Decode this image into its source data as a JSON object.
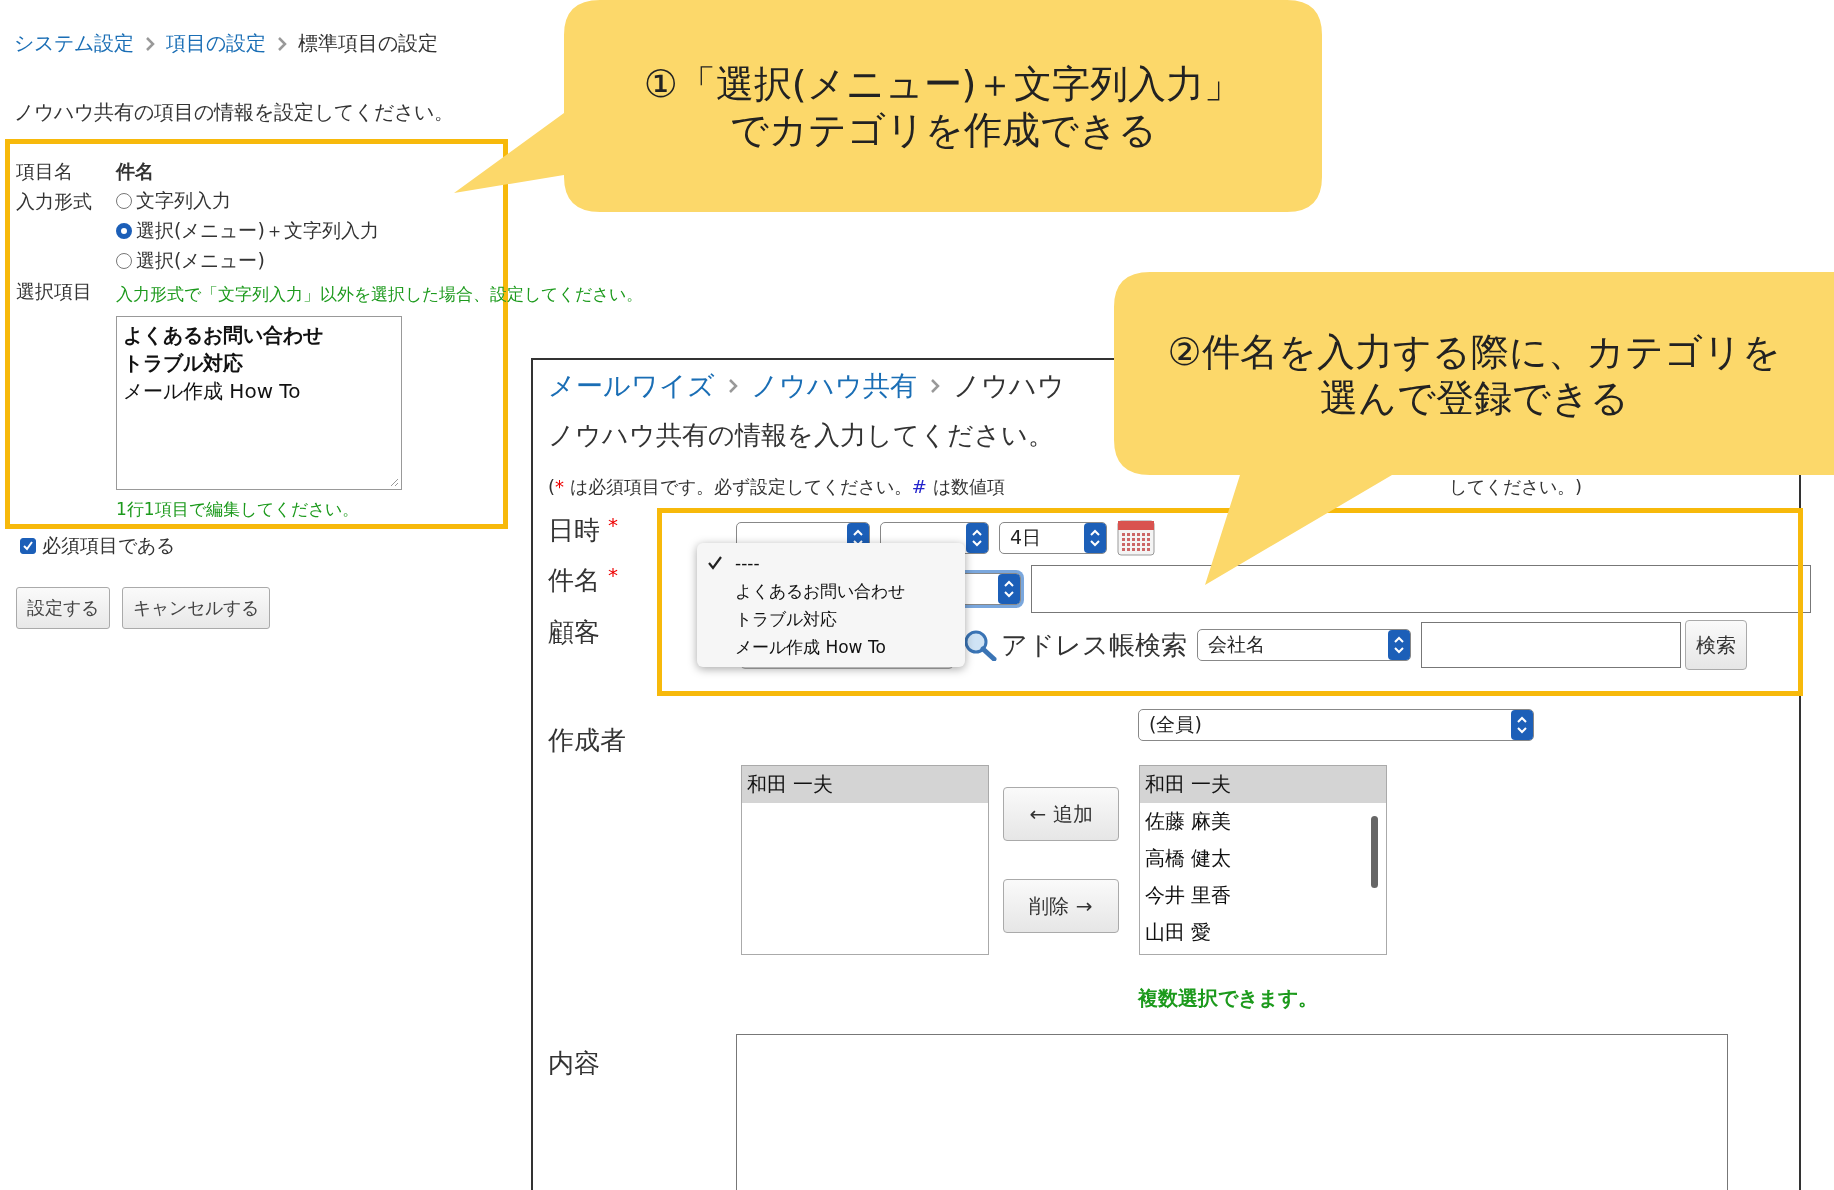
{
  "settings_page": {
    "breadcrumb": [
      {
        "label": "システム設定",
        "kind": "link"
      },
      {
        "label": "項目の設定",
        "kind": "link"
      },
      {
        "label": "標準項目の設定",
        "kind": "current"
      }
    ],
    "instruction": "ノウハウ共有の項目の情報を設定してください。",
    "item_name": {
      "label": "項目名",
      "value": "件名"
    },
    "input_type": {
      "label": "入力形式",
      "options": [
        {
          "label": "文字列入力",
          "selected": false
        },
        {
          "label": "選択(メニュー)＋文字列入力",
          "selected": true
        },
        {
          "label": "選択(メニュー)",
          "selected": false
        }
      ]
    },
    "choices": {
      "label": "選択項目",
      "hint": "入力形式で「文字列入力」以外を選択した場合、設定してください。",
      "lines": [
        "よくあるお問い合わせ",
        "トラブル対応",
        "メール作成 How To"
      ],
      "note": "1行1項目で編集してください。"
    },
    "required": {
      "label": "必須項目である",
      "checked": true
    },
    "buttons": [
      "設定する",
      "キャンセルする"
    ]
  },
  "form_page": {
    "breadcrumb": [
      {
        "label": "メールワイズ",
        "kind": "link"
      },
      {
        "label": "ノウハウ共有",
        "kind": "link"
      },
      {
        "label": "ノウハウ",
        "kind": "current"
      }
    ],
    "instruction": "ノウハウ共有の情報を入力してください。",
    "note_parts": [
      {
        "text": "(",
        "kind": "plain"
      },
      {
        "text": "*",
        "kind": "required"
      },
      {
        "text": " は必須項目です。必ず設定してください。",
        "kind": "plain"
      },
      {
        "text": "#",
        "kind": "numeric"
      },
      {
        "text": " は数値項",
        "kind": "plain"
      }
    ],
    "note_tail": "してください。)",
    "date": {
      "label": "日時",
      "required": true,
      "day": "4日"
    },
    "subject": {
      "label": "件名",
      "required": true
    },
    "customer": {
      "label": "顧客",
      "search_label": "アドレス帳検索",
      "search_field": "会社名",
      "search_button": "検索"
    },
    "menu": [
      {
        "label": "----",
        "checked": true
      },
      {
        "label": "よくあるお問い合わせ",
        "checked": false
      },
      {
        "label": "トラブル対応",
        "checked": false
      },
      {
        "label": "メール作成 How To",
        "checked": false
      }
    ],
    "author": {
      "label": "作成者",
      "group": "(全員)",
      "chosen": [
        {
          "label": "和田 一夫",
          "selected": true
        }
      ],
      "add_button": "← 追加",
      "remove_button": "削除 →",
      "candidates": [
        {
          "label": "和田 一夫",
          "selected": true
        },
        {
          "label": "佐藤 麻美",
          "selected": false
        },
        {
          "label": "高橋 健太",
          "selected": false
        },
        {
          "label": "今井 里香",
          "selected": false
        },
        {
          "label": "山田 愛",
          "selected": false
        }
      ],
      "hint": "複数選択できます。"
    },
    "content": {
      "label": "内容"
    }
  },
  "callouts": [
    {
      "lines": [
        "①「選択(メニュー)＋文字列入力」",
        "でカテゴリを作成できる"
      ]
    },
    {
      "lines": [
        "②件名を入力する際に、カテゴリを",
        "選んで登録できる"
      ]
    }
  ]
}
